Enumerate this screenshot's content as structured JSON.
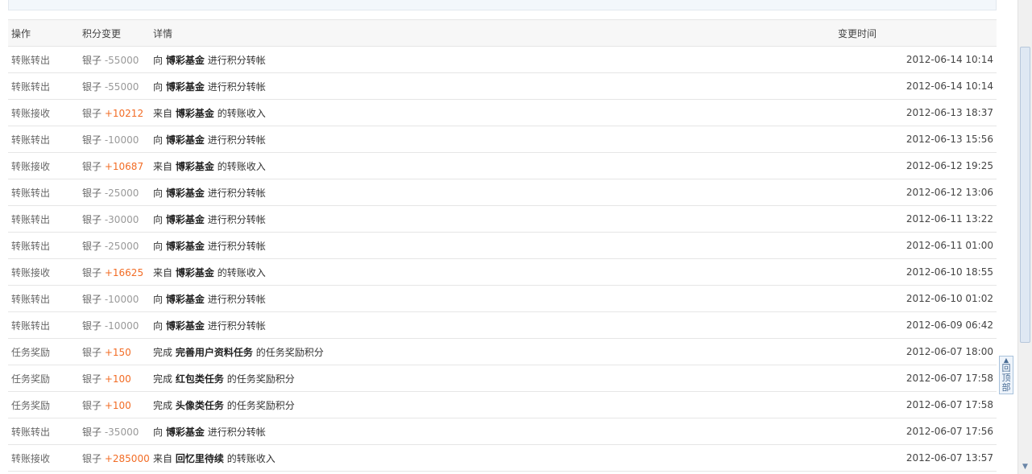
{
  "table": {
    "headers": {
      "action": "操作",
      "points": "积分变更",
      "detail": "详情",
      "time": "变更时间"
    },
    "rows": [
      {
        "action": "转账转出",
        "currency": "银子",
        "amount": "-55000",
        "pre": "向",
        "name": "博彩基金",
        "post": "进行积分转帐",
        "time": "2012-06-14 10:14"
      },
      {
        "action": "转账转出",
        "currency": "银子",
        "amount": "-55000",
        "pre": "向",
        "name": "博彩基金",
        "post": "进行积分转帐",
        "time": "2012-06-14 10:14"
      },
      {
        "action": "转账接收",
        "currency": "银子",
        "amount": "+10212",
        "pre": "来自",
        "name": "博彩基金",
        "post": "的转账收入",
        "time": "2012-06-13 18:37"
      },
      {
        "action": "转账转出",
        "currency": "银子",
        "amount": "-10000",
        "pre": "向",
        "name": "博彩基金",
        "post": "进行积分转帐",
        "time": "2012-06-13 15:56"
      },
      {
        "action": "转账接收",
        "currency": "银子",
        "amount": "+10687",
        "pre": "来自",
        "name": "博彩基金",
        "post": "的转账收入",
        "time": "2012-06-12 19:25"
      },
      {
        "action": "转账转出",
        "currency": "银子",
        "amount": "-25000",
        "pre": "向",
        "name": "博彩基金",
        "post": "进行积分转帐",
        "time": "2012-06-12 13:06"
      },
      {
        "action": "转账转出",
        "currency": "银子",
        "amount": "-30000",
        "pre": "向",
        "name": "博彩基金",
        "post": "进行积分转帐",
        "time": "2012-06-11 13:22"
      },
      {
        "action": "转账转出",
        "currency": "银子",
        "amount": "-25000",
        "pre": "向",
        "name": "博彩基金",
        "post": "进行积分转帐",
        "time": "2012-06-11 01:00"
      },
      {
        "action": "转账接收",
        "currency": "银子",
        "amount": "+16625",
        "pre": "来自",
        "name": "博彩基金",
        "post": "的转账收入",
        "time": "2012-06-10 18:55"
      },
      {
        "action": "转账转出",
        "currency": "银子",
        "amount": "-10000",
        "pre": "向",
        "name": "博彩基金",
        "post": "进行积分转帐",
        "time": "2012-06-10 01:02"
      },
      {
        "action": "转账转出",
        "currency": "银子",
        "amount": "-10000",
        "pre": "向",
        "name": "博彩基金",
        "post": "进行积分转帐",
        "time": "2012-06-09 06:42"
      },
      {
        "action": "任务奖励",
        "currency": "银子",
        "amount": "+150",
        "pre": "完成",
        "name": "完善用户资料任务",
        "post": "的任务奖励积分",
        "time": "2012-06-07 18:00"
      },
      {
        "action": "任务奖励",
        "currency": "银子",
        "amount": "+100",
        "pre": "完成",
        "name": "红包类任务",
        "post": "的任务奖励积分",
        "time": "2012-06-07 17:58"
      },
      {
        "action": "任务奖励",
        "currency": "银子",
        "amount": "+100",
        "pre": "完成",
        "name": "头像类任务",
        "post": "的任务奖励积分",
        "time": "2012-06-07 17:58"
      },
      {
        "action": "转账转出",
        "currency": "银子",
        "amount": "-35000",
        "pre": "向",
        "name": "博彩基金",
        "post": "进行积分转帐",
        "time": "2012-06-07 17:56"
      },
      {
        "action": "转账接收",
        "currency": "银子",
        "amount": "+285000",
        "pre": "来自",
        "name": "回忆里待续",
        "post": "的转账收入",
        "time": "2012-06-07 13:57"
      }
    ]
  },
  "back_to_top": {
    "label": "回顶部",
    "icon": "arrow-up-icon"
  },
  "colors": {
    "positive": "#f26c25",
    "negative": "#999999"
  }
}
